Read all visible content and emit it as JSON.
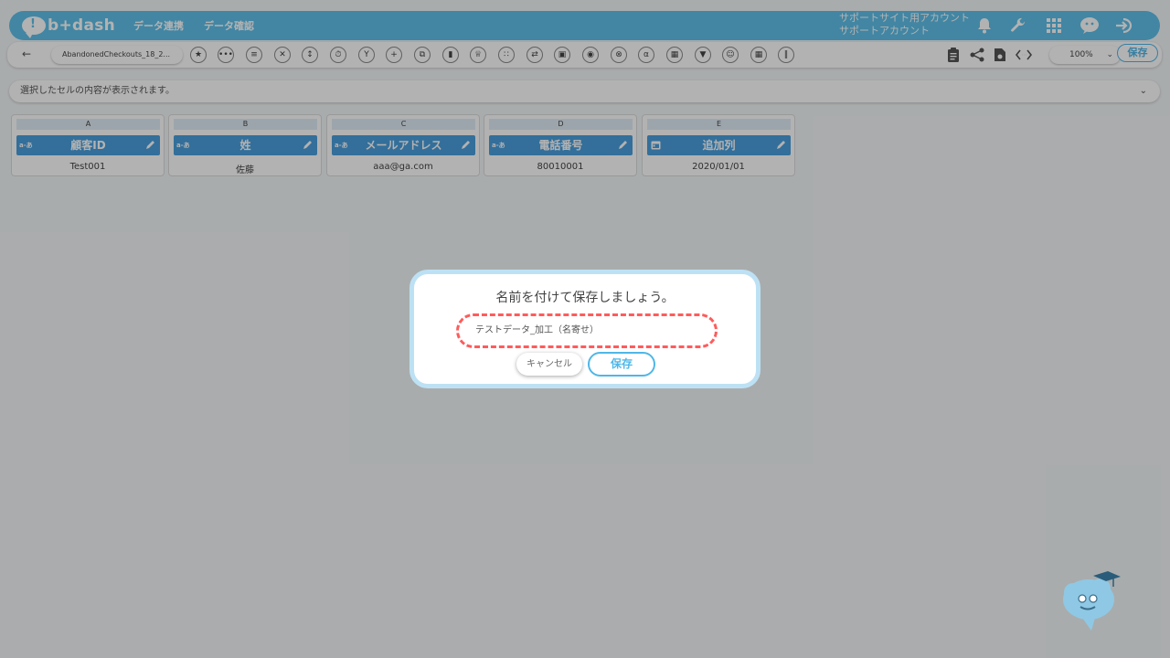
{
  "header": {
    "logo_text": "b+dash",
    "nav": [
      "データ連携",
      "データ確認"
    ],
    "account_line1": "サポートサイト用アカウント",
    "account_line2": "サポートアカウント"
  },
  "toolbar": {
    "file_name": "AbandonedCheckouts_18_2...",
    "zoom": "100%",
    "save_label": "保存"
  },
  "cellbar": {
    "placeholder": "選択したセルの内容が表示されます。"
  },
  "columns": [
    {
      "letter": "A",
      "type": "a-あ",
      "name": "顧客ID",
      "value": "Test001"
    },
    {
      "letter": "B",
      "type": "a-あ",
      "name": "姓",
      "value": "佐藤"
    },
    {
      "letter": "C",
      "type": "a-あ",
      "name": "メールアドレス",
      "value": "aaa@ga.com"
    },
    {
      "letter": "D",
      "type": "a-あ",
      "name": "電話番号",
      "value": "80010001"
    },
    {
      "letter": "E",
      "type": "date",
      "name": "追加列",
      "value": "2020/01/01"
    }
  ],
  "dialog": {
    "title": "名前を付けて保存しましょう。",
    "input_value": "テストデータ_加工（名寄せ）",
    "cancel_label": "キャンセル",
    "save_label": "保存"
  },
  "colors": {
    "brand": "#5fc0ea",
    "column_header": "#4a9fdd",
    "highlight": "#ff5b5b"
  }
}
